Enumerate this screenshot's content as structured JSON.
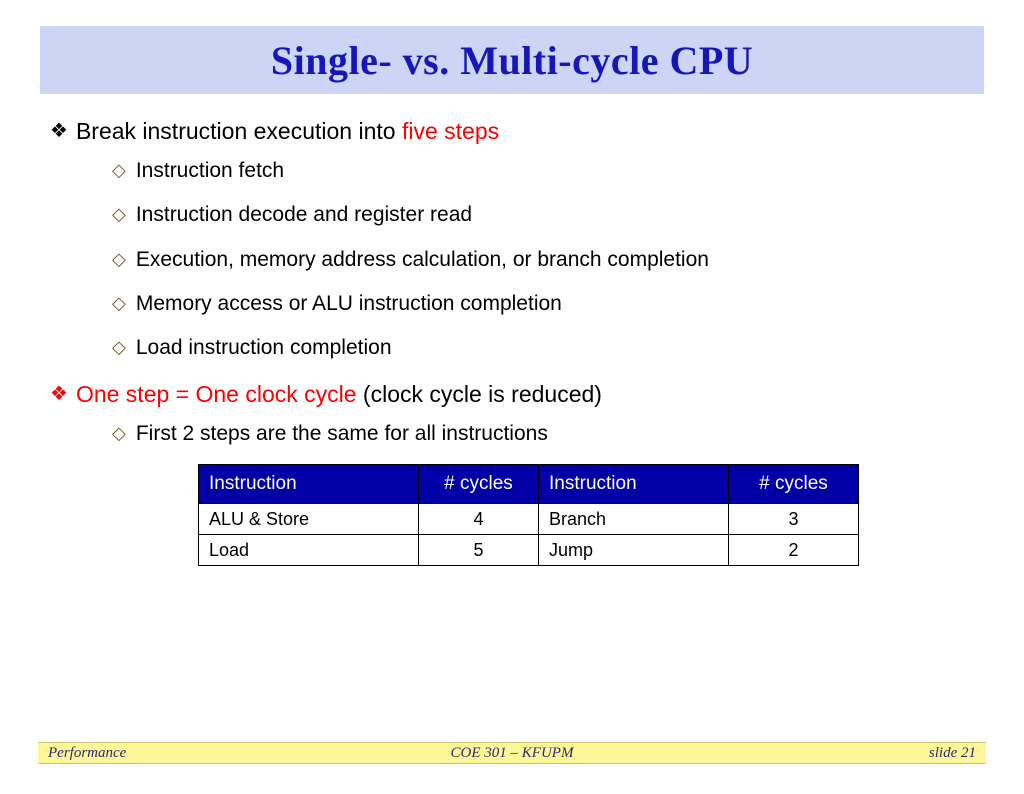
{
  "title": "Single- vs. Multi-cycle CPU",
  "bullet1": {
    "prefix": "Break instruction execution into ",
    "highlight": "five steps",
    "subs": [
      "Instruction fetch",
      "Instruction decode and register read",
      "Execution, memory address calculation, or branch completion",
      "Memory access or ALU instruction completion",
      "Load instruction completion"
    ]
  },
  "bullet2": {
    "highlight": "One step = One clock cycle",
    "suffix": " (clock cycle is reduced)",
    "subs": [
      "First 2 steps are the same for all instructions"
    ]
  },
  "table": {
    "headers": [
      "Instruction",
      "# cycles",
      "Instruction",
      "# cycles"
    ],
    "rows": [
      [
        "ALU & Store",
        "4",
        "Branch",
        "3"
      ],
      [
        "Load",
        "5",
        "Jump",
        "2"
      ]
    ]
  },
  "chart_data": {
    "type": "table",
    "title": "Instruction cycle counts",
    "columns": [
      "Instruction",
      "# cycles"
    ],
    "rows": [
      {
        "Instruction": "ALU & Store",
        "# cycles": 4
      },
      {
        "Instruction": "Branch",
        "# cycles": 3
      },
      {
        "Instruction": "Load",
        "# cycles": 5
      },
      {
        "Instruction": "Jump",
        "# cycles": 2
      }
    ]
  },
  "footer": {
    "left": "Performance",
    "center": "COE 301 – KFUPM",
    "right": "slide 21"
  }
}
